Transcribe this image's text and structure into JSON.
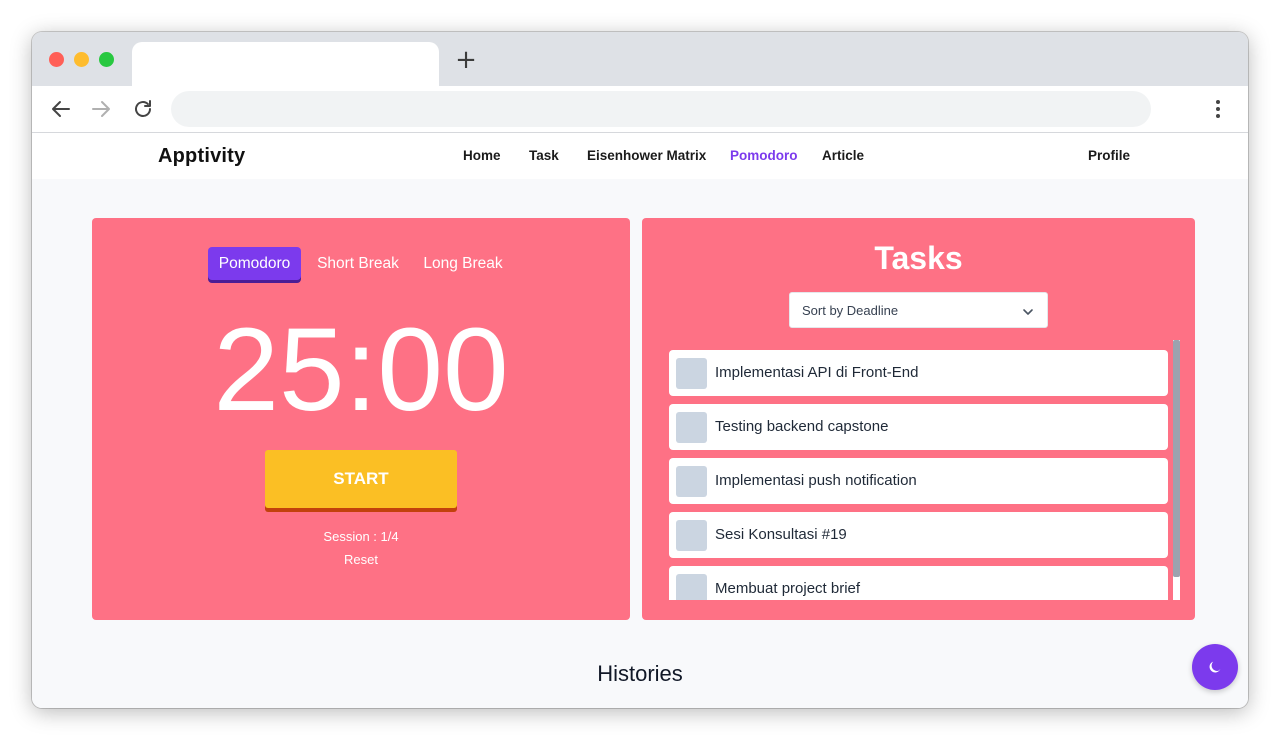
{
  "browser": {
    "new_tab_symbol": "+"
  },
  "nav": {
    "brand": "Apptivity",
    "links": [
      "Home",
      "Task",
      "Eisenhower Matrix",
      "Pomodoro",
      "Article"
    ],
    "active_link": "Pomodoro",
    "profile": "Profile"
  },
  "timer": {
    "modes": [
      "Pomodoro",
      "Short Break",
      "Long Break"
    ],
    "active_mode": "Pomodoro",
    "time": "25:00",
    "start_label": "START",
    "session_text": "Session : 1/4",
    "reset_label": "Reset"
  },
  "tasks": {
    "title": "Tasks",
    "sort_value": "Sort by Deadline",
    "items": [
      "Implementasi API di Front-End",
      "Testing backend capstone",
      "Implementasi push notification",
      "Sesi Konsultasi #19",
      "Membuat project brief"
    ]
  },
  "histories": {
    "title": "Histories"
  },
  "theme_toggle": {
    "icon": "moon-icon"
  },
  "colors": {
    "accent": "#7c3aed",
    "panel": "#fe7185",
    "start_button": "#fbbf24",
    "checkbox": "#cbd5e1"
  }
}
